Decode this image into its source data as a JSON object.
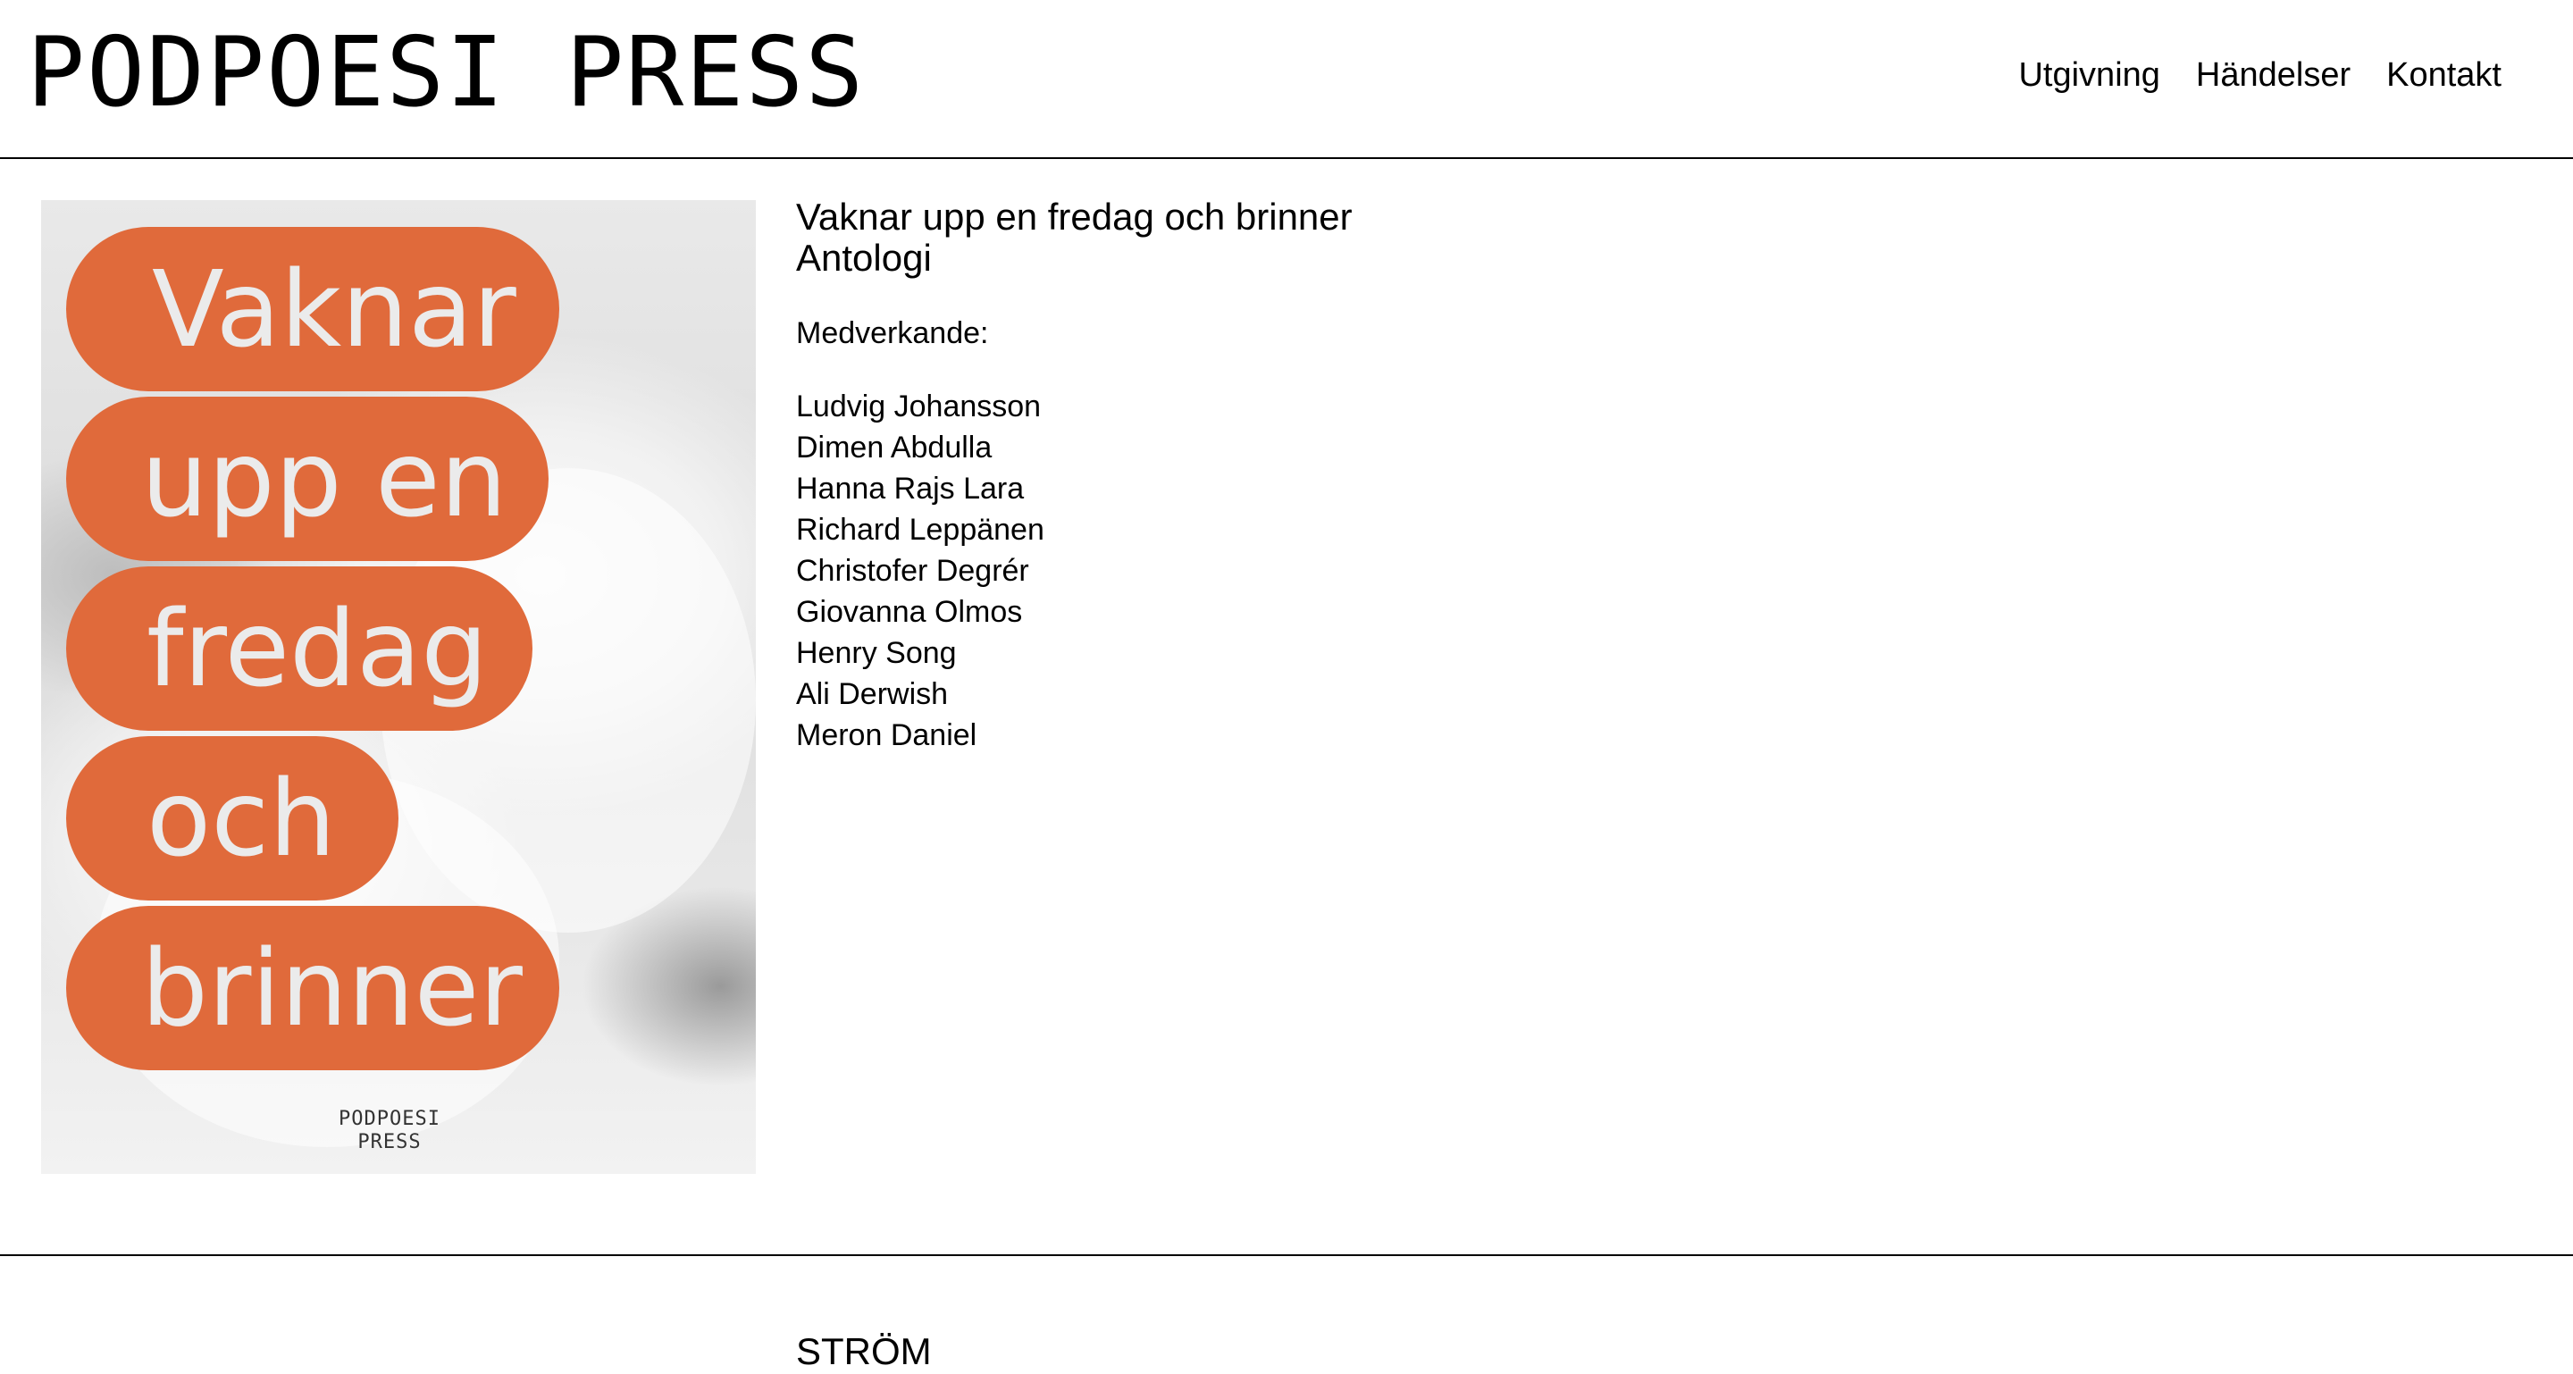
{
  "header": {
    "logo": "PODPOESI PRESS",
    "nav": [
      {
        "label": "Utgivning"
      },
      {
        "label": "Händelser"
      },
      {
        "label": "Kontakt"
      }
    ]
  },
  "book": {
    "cover": {
      "title_lines": [
        "Vaknar",
        "upp en",
        "fredag",
        "och",
        "brinner"
      ],
      "imprint_lines": [
        "PODPOESI",
        "PRESS"
      ],
      "accent_color": "#e06a3b"
    },
    "title": "Vaknar upp en fredag och brinner",
    "subtitle": "Antologi",
    "contributors_heading": "Medverkande:",
    "contributors": [
      "Ludvig Johansson",
      "Dimen Abdulla",
      "Hanna Rajs Lara",
      "Richard Leppänen",
      "Christofer Degrér",
      "Giovanna Olmos",
      "Henry Song",
      "Ali Derwish",
      "Meron Daniel"
    ]
  },
  "next_section": {
    "title": "STRÖM"
  }
}
